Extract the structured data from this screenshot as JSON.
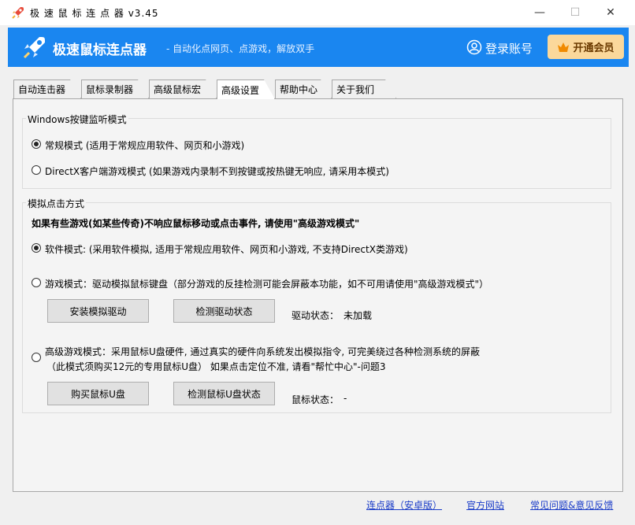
{
  "window": {
    "title": "极 速 鼠 标 连 点 器 v3.45",
    "minimize_glyph": "—",
    "maximize_glyph": "☐",
    "close_glyph": "✕"
  },
  "banner": {
    "brand": "极速鼠标连点器",
    "slogan": "- 自动化点网页、点游戏，解放双手",
    "login": "登录账号",
    "vip_button": "开通会员"
  },
  "tabs": [
    "自动连击器",
    "鼠标录制器",
    "高级鼠标宏",
    "高级设置",
    "帮助中心",
    "关于我们"
  ],
  "active_tab": "高级设置",
  "listen_group": {
    "legend": "Windows按键监听模式",
    "option_normal": "常规模式 (适用于常规应用软件、网页和小游戏)",
    "option_directx": "DirectX客户端游戏模式 (如果游戏内录制不到按键或按热键无响应, 请采用本模式)",
    "selected": "normal"
  },
  "click_group": {
    "legend": "模拟点击方式",
    "notice": "如果有些游戏(如某些传奇)不响应鼠标移动或点击事件, 请使用\"高级游戏模式\"",
    "option_software": "软件模式:  (采用软件模拟, 适用于常规应用软件、网页和小游戏, 不支持DirectX类游戏)",
    "option_game": "游戏模式：驱动模拟鼠标键盘（部分游戏的反挂检测可能会屏蔽本功能，如不可用请使用\"高级游戏模式\"）",
    "btn_install_driver": "安装模拟驱动",
    "btn_check_driver": "检测驱动状态",
    "driver_status_label": "驱动状态：",
    "driver_status_value": "未加载",
    "option_advanced_line1": "高级游戏模式：采用鼠标U盘硬件, 通过真实的硬件向系统发出模拟指令, 可完美绕过各种检测系统的屏蔽",
    "option_advanced_line2": "（此模式须购买12元的专用鼠标U盘） 如果点击定位不准, 请看\"帮忙中心\"-问题3",
    "btn_buy_usb": "购买鼠标U盘",
    "btn_check_usb": "检测鼠标U盘状态",
    "usb_status_label": "鼠标状态：",
    "usb_status_value": "-",
    "selected": "software"
  },
  "footer": {
    "link_android": "连点器（安卓版）",
    "link_site": "官方网站",
    "link_faq": "常见问题&意见反馈"
  },
  "colors": {
    "banner": "#1a86f0",
    "vip": "#fbd89b",
    "link": "#1a3cc8"
  }
}
